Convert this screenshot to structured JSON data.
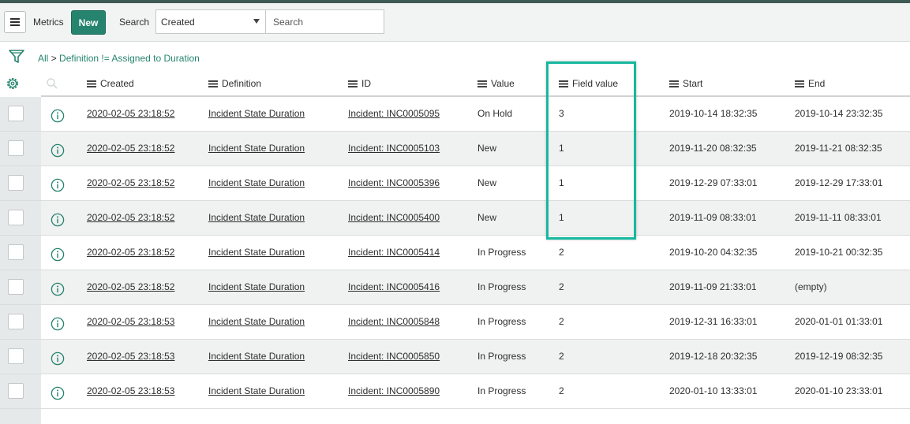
{
  "header": {
    "title": "Metrics",
    "new_label": "New",
    "search_label": "Search",
    "search_field_selected": "Created",
    "search_placeholder": "Search"
  },
  "breadcrumb": {
    "all": "All",
    "separator": ">",
    "condition": "Definition != Assigned to Duration"
  },
  "columns": [
    "Created",
    "Definition",
    "ID",
    "Value",
    "Field value",
    "Start",
    "End"
  ],
  "rows": [
    {
      "created": "2020-02-05 23:18:52",
      "definition": "Incident State Duration",
      "id": "Incident: INC0005095",
      "value": "On Hold",
      "field_value": "3",
      "start": "2019-10-14 18:32:35",
      "end": "2019-10-14 23:32:35"
    },
    {
      "created": "2020-02-05 23:18:52",
      "definition": "Incident State Duration",
      "id": "Incident: INC0005103",
      "value": "New",
      "field_value": "1",
      "start": "2019-11-20 08:32:35",
      "end": "2019-11-21 08:32:35"
    },
    {
      "created": "2020-02-05 23:18:52",
      "definition": "Incident State Duration",
      "id": "Incident: INC0005396",
      "value": "New",
      "field_value": "1",
      "start": "2019-12-29 07:33:01",
      "end": "2019-12-29 17:33:01"
    },
    {
      "created": "2020-02-05 23:18:52",
      "definition": "Incident State Duration",
      "id": "Incident: INC0005400",
      "value": "New",
      "field_value": "1",
      "start": "2019-11-09 08:33:01",
      "end": "2019-11-11 08:33:01"
    },
    {
      "created": "2020-02-05 23:18:52",
      "definition": "Incident State Duration",
      "id": "Incident: INC0005414",
      "value": "In Progress",
      "field_value": "2",
      "start": "2019-10-20 04:32:35",
      "end": "2019-10-21 00:32:35"
    },
    {
      "created": "2020-02-05 23:18:52",
      "definition": "Incident State Duration",
      "id": "Incident: INC0005416",
      "value": "In Progress",
      "field_value": "2",
      "start": "2019-11-09 21:33:01",
      "end": "(empty)"
    },
    {
      "created": "2020-02-05 23:18:53",
      "definition": "Incident State Duration",
      "id": "Incident: INC0005848",
      "value": "In Progress",
      "field_value": "2",
      "start": "2019-12-31 16:33:01",
      "end": "2020-01-01 01:33:01"
    },
    {
      "created": "2020-02-05 23:18:53",
      "definition": "Incident State Duration",
      "id": "Incident: INC0005850",
      "value": "In Progress",
      "field_value": "2",
      "start": "2019-12-18 20:32:35",
      "end": "2019-12-19 08:32:35"
    },
    {
      "created": "2020-02-05 23:18:53",
      "definition": "Incident State Duration",
      "id": "Incident: INC0005890",
      "value": "In Progress",
      "field_value": "2",
      "start": "2020-01-10 13:33:01",
      "end": "2020-01-10 23:33:01"
    }
  ],
  "colors": {
    "accent": "#26846e",
    "highlight": "#16b89e",
    "row_alt": "#f0f1f1"
  }
}
